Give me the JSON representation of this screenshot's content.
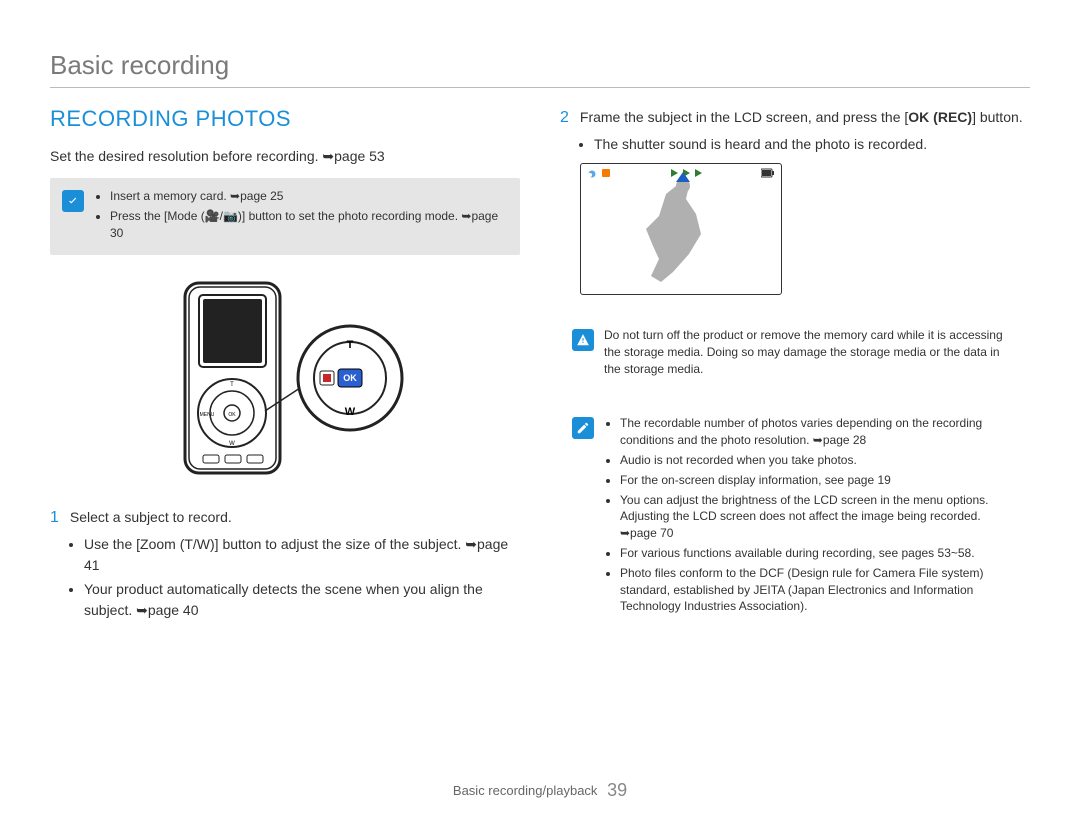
{
  "header": {
    "title": "Basic recording"
  },
  "left": {
    "section_title": "RECORDING PHOTOS",
    "intro": "Set the desired resolution before recording. ➥page 53",
    "prereq": {
      "items": [
        "Insert a memory card. ➥page 25",
        "Press the [Mode (🎥/📷)] button to set the photo recording mode. ➥page 30"
      ]
    },
    "step1": {
      "num": "1",
      "title": "Select a subject to record.",
      "bullets": [
        "Use the [Zoom (T/W)] button to adjust the size of the subject. ➥page 41",
        "Your product automatically detects the scene when you align the subject. ➥page 40"
      ]
    }
  },
  "right": {
    "step2": {
      "num": "2",
      "title_a": "Frame the subject in the LCD screen, and press the ",
      "title_b": "[OK (REC)]",
      "title_c": " button.",
      "bullet": "The shutter sound is heard and the photo is recorded."
    },
    "warn": {
      "text": "Do not turn off the product or remove the memory card while it is accessing the storage media. Doing so may damage the storage media or the data in the storage media."
    },
    "notes": {
      "items": [
        "The recordable number of photos varies depending on the recording conditions and the photo resolution. ➥page 28",
        "Audio is not recorded when you take photos.",
        "For the on-screen display information, see page 19",
        "You can adjust the brightness of the LCD screen in the menu options. Adjusting the LCD screen does not affect the image being recorded. ➥page 70",
        "For various functions available during recording, see pages 53~58.",
        "Photo files conform to the DCF (Design rule for Camera File system) standard, established by JEITA (Japan Electronics and Information Technology Industries Association)."
      ]
    }
  },
  "footer": {
    "section": "Basic recording/playback",
    "page": "39"
  }
}
